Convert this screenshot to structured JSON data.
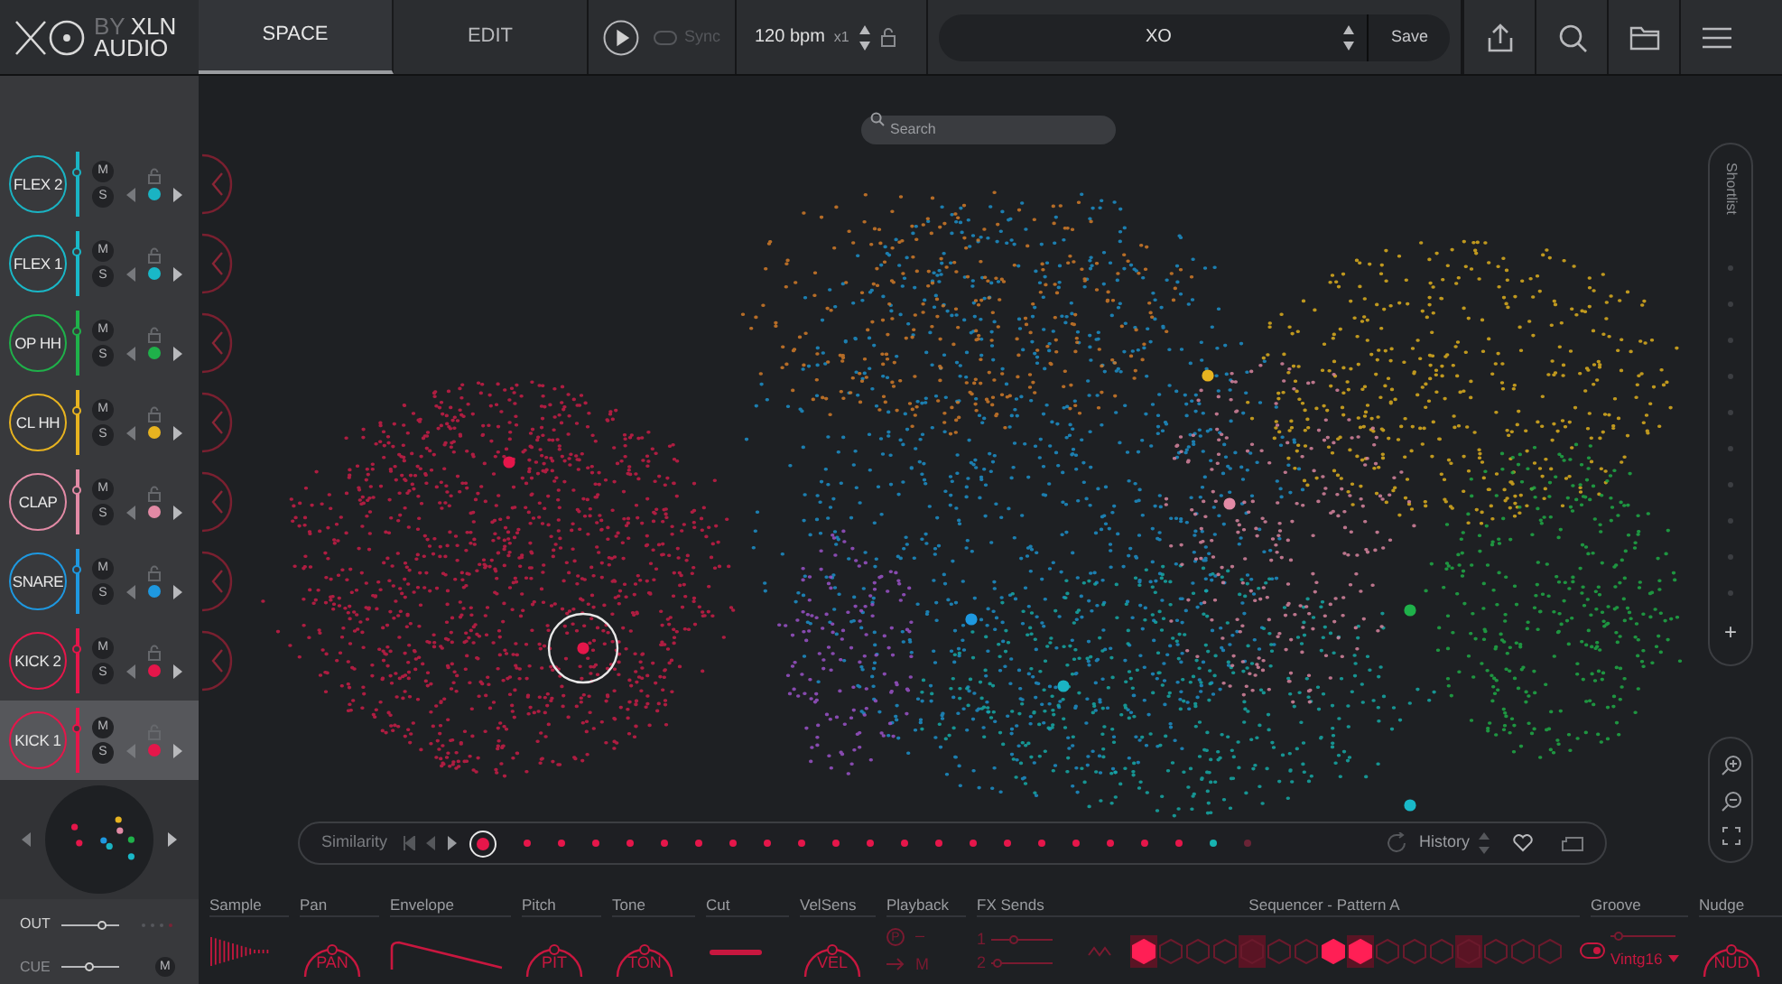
{
  "header": {
    "by": "BY",
    "brand_lines": [
      "XLN",
      "AUDIO"
    ],
    "tabs": [
      {
        "label": "SPACE",
        "selected": true
      },
      {
        "label": "EDIT",
        "selected": false
      }
    ],
    "transport": {
      "playing": false,
      "sync_label": "Sync",
      "sync_on": false,
      "tempo": "120 bpm",
      "multiplier": "x1",
      "locked": false
    },
    "preset": {
      "name": "XO",
      "save": "Save"
    }
  },
  "search": {
    "placeholder": "Search"
  },
  "channels": [
    {
      "name": "FLEX 2",
      "color": "#1ab3c3",
      "selected": false,
      "level": 0.7,
      "mute": "M",
      "solo": "S"
    },
    {
      "name": "FLEX 1",
      "color": "#19b8c8",
      "selected": false,
      "level": 0.7,
      "mute": "M",
      "solo": "S"
    },
    {
      "name": "OP HH",
      "color": "#1fb14a",
      "selected": false,
      "level": 0.7,
      "mute": "M",
      "solo": "S"
    },
    {
      "name": "CL HH",
      "color": "#e7b320",
      "selected": false,
      "level": 0.7,
      "mute": "M",
      "solo": "S"
    },
    {
      "name": "CLAP",
      "color": "#e28aa5",
      "selected": false,
      "level": 0.7,
      "mute": "M",
      "solo": "S"
    },
    {
      "name": "SNARE",
      "color": "#1e98e0",
      "selected": false,
      "level": 0.7,
      "mute": "M",
      "solo": "S"
    },
    {
      "name": "KICK 2",
      "color": "#e5164a",
      "selected": false,
      "level": 0.7,
      "mute": "M",
      "solo": "S"
    },
    {
      "name": "KICK 1",
      "color": "#e5164a",
      "selected": true,
      "level": 0.7,
      "mute": "M",
      "solo": "S"
    }
  ],
  "output": {
    "out": {
      "label": "OUT",
      "level": 0.75
    },
    "cue": {
      "label": "CUE",
      "level": 0.5,
      "mute": "M"
    }
  },
  "shortlist": {
    "title": "Shortlist",
    "add": "+"
  },
  "similarity": {
    "label": "Similarity",
    "history": "History",
    "results": [
      {
        "color": "#e5164a",
        "selected": true
      },
      {
        "color": "#e5164a",
        "selected": false
      },
      {
        "color": "#e5164a",
        "selected": false
      },
      {
        "color": "#e5164a",
        "selected": false
      },
      {
        "color": "#e5164a",
        "selected": false
      },
      {
        "color": "#e5164a",
        "selected": false
      },
      {
        "color": "#e5164a",
        "selected": false
      },
      {
        "color": "#e5164a",
        "selected": false
      },
      {
        "color": "#e5164a",
        "selected": false
      },
      {
        "color": "#e5164a",
        "selected": false
      },
      {
        "color": "#e5164a",
        "selected": false
      },
      {
        "color": "#e5164a",
        "selected": false
      },
      {
        "color": "#e5164a",
        "selected": false
      },
      {
        "color": "#e5164a",
        "selected": false
      },
      {
        "color": "#e5164a",
        "selected": false
      },
      {
        "color": "#e5164a",
        "selected": false
      },
      {
        "color": "#e5164a",
        "selected": false
      },
      {
        "color": "#e5164a",
        "selected": false
      },
      {
        "color": "#e5164a",
        "selected": false
      },
      {
        "color": "#e5164a",
        "selected": false
      },
      {
        "color": "#e5164a",
        "selected": false
      },
      {
        "color": "#17b3b0",
        "selected": false
      },
      {
        "color": "#6a2436",
        "selected": false
      }
    ]
  },
  "sections": [
    {
      "title": "Sample",
      "kind": "waveform"
    },
    {
      "title": "Pan",
      "kind": "knob",
      "label": "PAN"
    },
    {
      "title": "Envelope",
      "kind": "envelope"
    },
    {
      "title": "Pitch",
      "kind": "knob",
      "label": "PIT"
    },
    {
      "title": "Tone",
      "kind": "knob",
      "label": "TON"
    },
    {
      "title": "Cut",
      "kind": "slider",
      "level": 0.8
    },
    {
      "title": "VelSens",
      "kind": "knob",
      "label": "VEL"
    },
    {
      "title": "Playback",
      "kind": "playback",
      "mode": "P",
      "dash": "–",
      "mono": "M"
    },
    {
      "title": "FX Sends",
      "kind": "sends",
      "sends": [
        {
          "label": "1",
          "level": 0.35
        },
        {
          "label": "2",
          "level": 0.05
        }
      ]
    },
    {
      "title": "Sequencer - Pattern A",
      "kind": "sequencer",
      "steps": [
        {
          "on": true,
          "accent": true
        },
        {
          "on": false,
          "accent": false
        },
        {
          "on": false,
          "accent": false
        },
        {
          "on": false,
          "accent": false
        },
        {
          "on": false,
          "accent": true
        },
        {
          "on": false,
          "accent": false
        },
        {
          "on": false,
          "accent": false
        },
        {
          "on": true,
          "accent": false
        },
        {
          "on": true,
          "accent": true
        },
        {
          "on": false,
          "accent": false
        },
        {
          "on": false,
          "accent": false
        },
        {
          "on": false,
          "accent": false
        },
        {
          "on": false,
          "accent": true
        },
        {
          "on": false,
          "accent": false
        },
        {
          "on": false,
          "accent": false
        },
        {
          "on": false,
          "accent": false
        }
      ]
    },
    {
      "title": "Groove",
      "kind": "groove",
      "groove": "Vintg16",
      "level": 0.05,
      "on": true
    },
    {
      "title": "Nudge",
      "kind": "knob",
      "label": "NUD"
    }
  ]
}
